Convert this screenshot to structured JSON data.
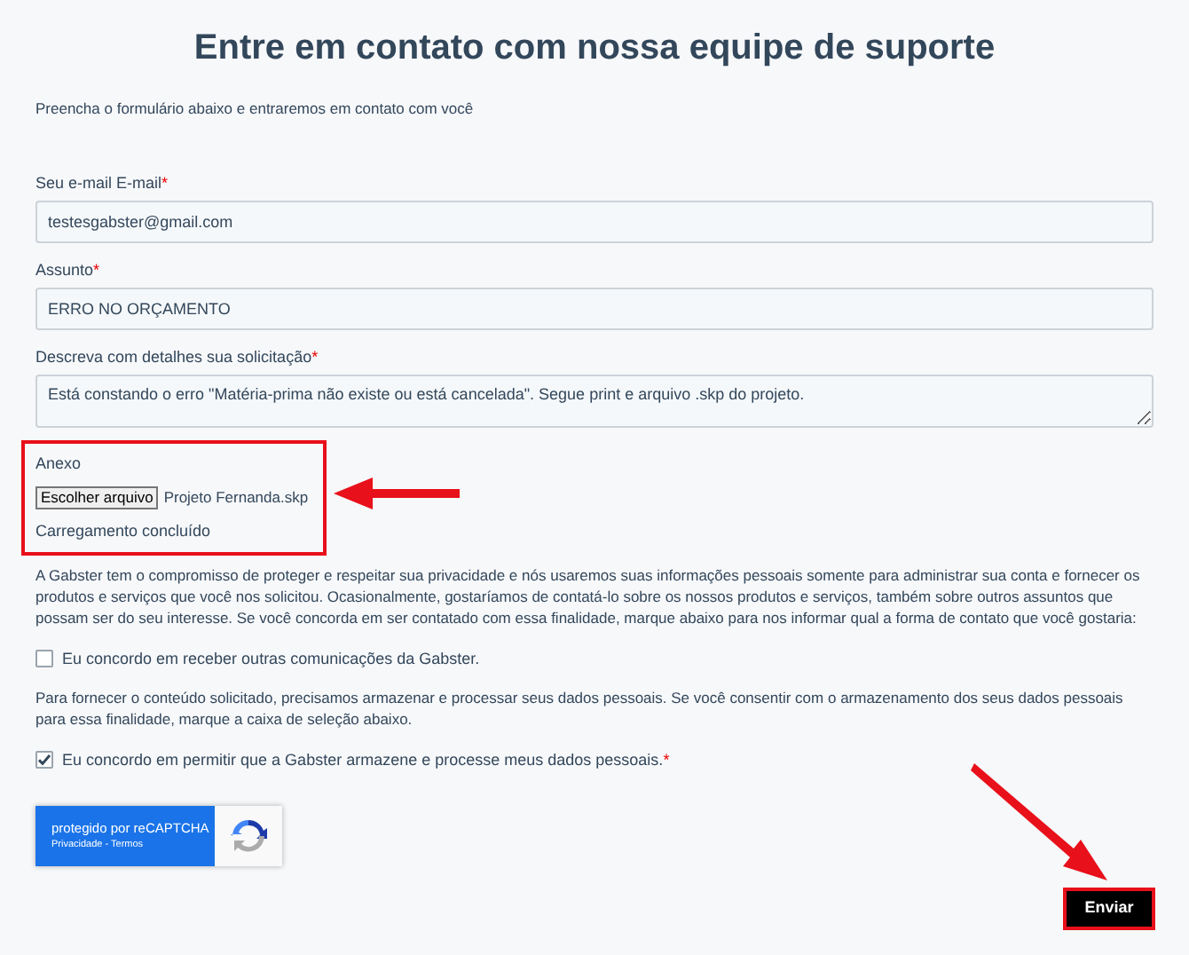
{
  "title": "Entre em contato com nossa equipe de suporte",
  "intro": "Preencha o formulário abaixo e entraremos em contato com você",
  "fields": [
    {
      "kind": "input",
      "label": "Seu e-mail E-mail",
      "required_mark": "*",
      "value": "testesgabster@gmail.com"
    },
    {
      "kind": "input",
      "label": "Assunto",
      "required_mark": "*",
      "value": "ERRO NO ORÇAMENTO"
    },
    {
      "kind": "textarea",
      "label": "Descreva com detalhes sua solicitação",
      "required_mark": "*",
      "value": "Está constando o erro \"Matéria-prima não existe ou está cancelada\". Segue print e arquivo .skp do projeto."
    }
  ],
  "attachment": {
    "label": "Anexo",
    "button": "Escolher arquivo",
    "file_name": "Projeto Fernanda.skp",
    "status": "Carregamento concluído",
    "highlighted": true
  },
  "privacy_text": "A Gabster tem o compromisso de proteger e respeitar sua privacidade e nós usaremos suas informações pessoais somente para administrar sua conta e fornecer os produtos e serviços que você nos solicitou. Ocasionalmente, gostaríamos de contatá-lo sobre os nossos produtos e serviços, também sobre outros assuntos que possam ser do seu interesse. Se você concorda em ser contatado com essa finalidade, marque abaixo para nos informar qual a forma de contato que você gostaria:",
  "consents": [
    {
      "label": "Eu concordo em receber outras comunicações da Gabster.",
      "checked": false,
      "note": "Para fornecer o conteúdo solicitado, precisamos armazenar e processar seus dados pessoais. Se você consentir com o armazenamento dos seus dados pessoais para essa finalidade, marque a caixa de seleção abaixo."
    },
    {
      "label": "Eu concordo em permitir que a Gabster armazene e processe meus dados pessoais.",
      "checked": true,
      "required_mark": "*"
    }
  ],
  "recaptcha": {
    "title": "protegido por reCAPTCHA",
    "links": "Privacidade - Termos"
  },
  "submit": {
    "label": "Enviar",
    "highlighted": true
  }
}
